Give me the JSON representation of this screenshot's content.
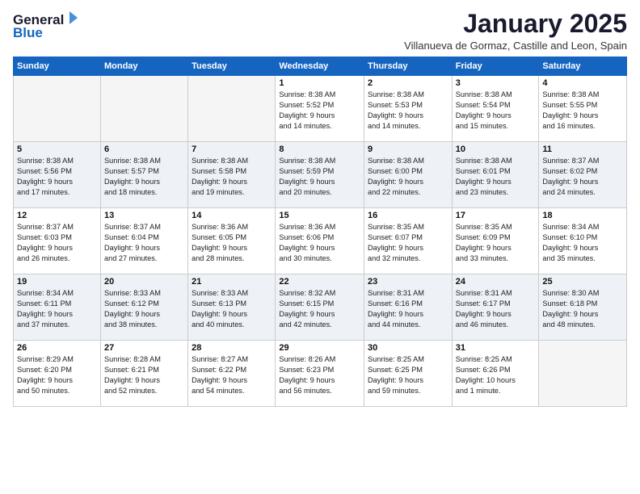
{
  "logo": {
    "line1": "General",
    "line2": "Blue"
  },
  "title": "January 2025",
  "subtitle": "Villanueva de Gormaz, Castille and Leon, Spain",
  "weekdays": [
    "Sunday",
    "Monday",
    "Tuesday",
    "Wednesday",
    "Thursday",
    "Friday",
    "Saturday"
  ],
  "weeks": [
    [
      {
        "day": "",
        "info": ""
      },
      {
        "day": "",
        "info": ""
      },
      {
        "day": "",
        "info": ""
      },
      {
        "day": "1",
        "info": "Sunrise: 8:38 AM\nSunset: 5:52 PM\nDaylight: 9 hours\nand 14 minutes."
      },
      {
        "day": "2",
        "info": "Sunrise: 8:38 AM\nSunset: 5:53 PM\nDaylight: 9 hours\nand 14 minutes."
      },
      {
        "day": "3",
        "info": "Sunrise: 8:38 AM\nSunset: 5:54 PM\nDaylight: 9 hours\nand 15 minutes."
      },
      {
        "day": "4",
        "info": "Sunrise: 8:38 AM\nSunset: 5:55 PM\nDaylight: 9 hours\nand 16 minutes."
      }
    ],
    [
      {
        "day": "5",
        "info": "Sunrise: 8:38 AM\nSunset: 5:56 PM\nDaylight: 9 hours\nand 17 minutes."
      },
      {
        "day": "6",
        "info": "Sunrise: 8:38 AM\nSunset: 5:57 PM\nDaylight: 9 hours\nand 18 minutes."
      },
      {
        "day": "7",
        "info": "Sunrise: 8:38 AM\nSunset: 5:58 PM\nDaylight: 9 hours\nand 19 minutes."
      },
      {
        "day": "8",
        "info": "Sunrise: 8:38 AM\nSunset: 5:59 PM\nDaylight: 9 hours\nand 20 minutes."
      },
      {
        "day": "9",
        "info": "Sunrise: 8:38 AM\nSunset: 6:00 PM\nDaylight: 9 hours\nand 22 minutes."
      },
      {
        "day": "10",
        "info": "Sunrise: 8:38 AM\nSunset: 6:01 PM\nDaylight: 9 hours\nand 23 minutes."
      },
      {
        "day": "11",
        "info": "Sunrise: 8:37 AM\nSunset: 6:02 PM\nDaylight: 9 hours\nand 24 minutes."
      }
    ],
    [
      {
        "day": "12",
        "info": "Sunrise: 8:37 AM\nSunset: 6:03 PM\nDaylight: 9 hours\nand 26 minutes."
      },
      {
        "day": "13",
        "info": "Sunrise: 8:37 AM\nSunset: 6:04 PM\nDaylight: 9 hours\nand 27 minutes."
      },
      {
        "day": "14",
        "info": "Sunrise: 8:36 AM\nSunset: 6:05 PM\nDaylight: 9 hours\nand 28 minutes."
      },
      {
        "day": "15",
        "info": "Sunrise: 8:36 AM\nSunset: 6:06 PM\nDaylight: 9 hours\nand 30 minutes."
      },
      {
        "day": "16",
        "info": "Sunrise: 8:35 AM\nSunset: 6:07 PM\nDaylight: 9 hours\nand 32 minutes."
      },
      {
        "day": "17",
        "info": "Sunrise: 8:35 AM\nSunset: 6:09 PM\nDaylight: 9 hours\nand 33 minutes."
      },
      {
        "day": "18",
        "info": "Sunrise: 8:34 AM\nSunset: 6:10 PM\nDaylight: 9 hours\nand 35 minutes."
      }
    ],
    [
      {
        "day": "19",
        "info": "Sunrise: 8:34 AM\nSunset: 6:11 PM\nDaylight: 9 hours\nand 37 minutes."
      },
      {
        "day": "20",
        "info": "Sunrise: 8:33 AM\nSunset: 6:12 PM\nDaylight: 9 hours\nand 38 minutes."
      },
      {
        "day": "21",
        "info": "Sunrise: 8:33 AM\nSunset: 6:13 PM\nDaylight: 9 hours\nand 40 minutes."
      },
      {
        "day": "22",
        "info": "Sunrise: 8:32 AM\nSunset: 6:15 PM\nDaylight: 9 hours\nand 42 minutes."
      },
      {
        "day": "23",
        "info": "Sunrise: 8:31 AM\nSunset: 6:16 PM\nDaylight: 9 hours\nand 44 minutes."
      },
      {
        "day": "24",
        "info": "Sunrise: 8:31 AM\nSunset: 6:17 PM\nDaylight: 9 hours\nand 46 minutes."
      },
      {
        "day": "25",
        "info": "Sunrise: 8:30 AM\nSunset: 6:18 PM\nDaylight: 9 hours\nand 48 minutes."
      }
    ],
    [
      {
        "day": "26",
        "info": "Sunrise: 8:29 AM\nSunset: 6:20 PM\nDaylight: 9 hours\nand 50 minutes."
      },
      {
        "day": "27",
        "info": "Sunrise: 8:28 AM\nSunset: 6:21 PM\nDaylight: 9 hours\nand 52 minutes."
      },
      {
        "day": "28",
        "info": "Sunrise: 8:27 AM\nSunset: 6:22 PM\nDaylight: 9 hours\nand 54 minutes."
      },
      {
        "day": "29",
        "info": "Sunrise: 8:26 AM\nSunset: 6:23 PM\nDaylight: 9 hours\nand 56 minutes."
      },
      {
        "day": "30",
        "info": "Sunrise: 8:25 AM\nSunset: 6:25 PM\nDaylight: 9 hours\nand 59 minutes."
      },
      {
        "day": "31",
        "info": "Sunrise: 8:25 AM\nSunset: 6:26 PM\nDaylight: 10 hours\nand 1 minute."
      },
      {
        "day": "",
        "info": ""
      }
    ]
  ]
}
